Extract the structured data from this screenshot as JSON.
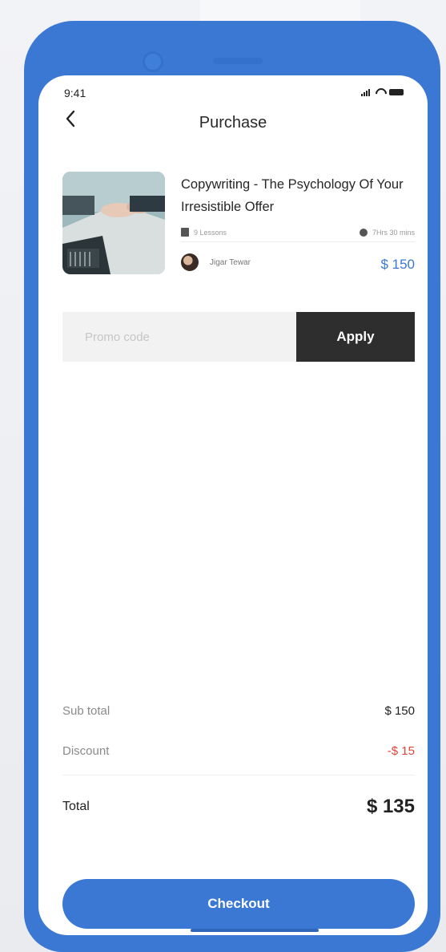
{
  "status_bar": {
    "time": "9:41"
  },
  "header": {
    "title": "Purchase"
  },
  "course": {
    "title": "Copywriting - The Psychology Of Your Irresistible Offer",
    "lessons": "9 Lessons",
    "duration": "7Hrs 30 mins",
    "author": "Jigar Tewar",
    "price": "$ 150"
  },
  "promo": {
    "placeholder": "Promo code",
    "apply_label": "Apply"
  },
  "summary": {
    "subtotal_label": "Sub total",
    "subtotal_value": "$ 150",
    "discount_label": "Discount",
    "discount_value": "-$ 15",
    "total_label": "Total",
    "total_value": "$ 135"
  },
  "checkout_label": "Checkout",
  "colors": {
    "accent": "#3a78d4",
    "discount": "#e0453a",
    "apply_bg": "#2e2e2e"
  }
}
